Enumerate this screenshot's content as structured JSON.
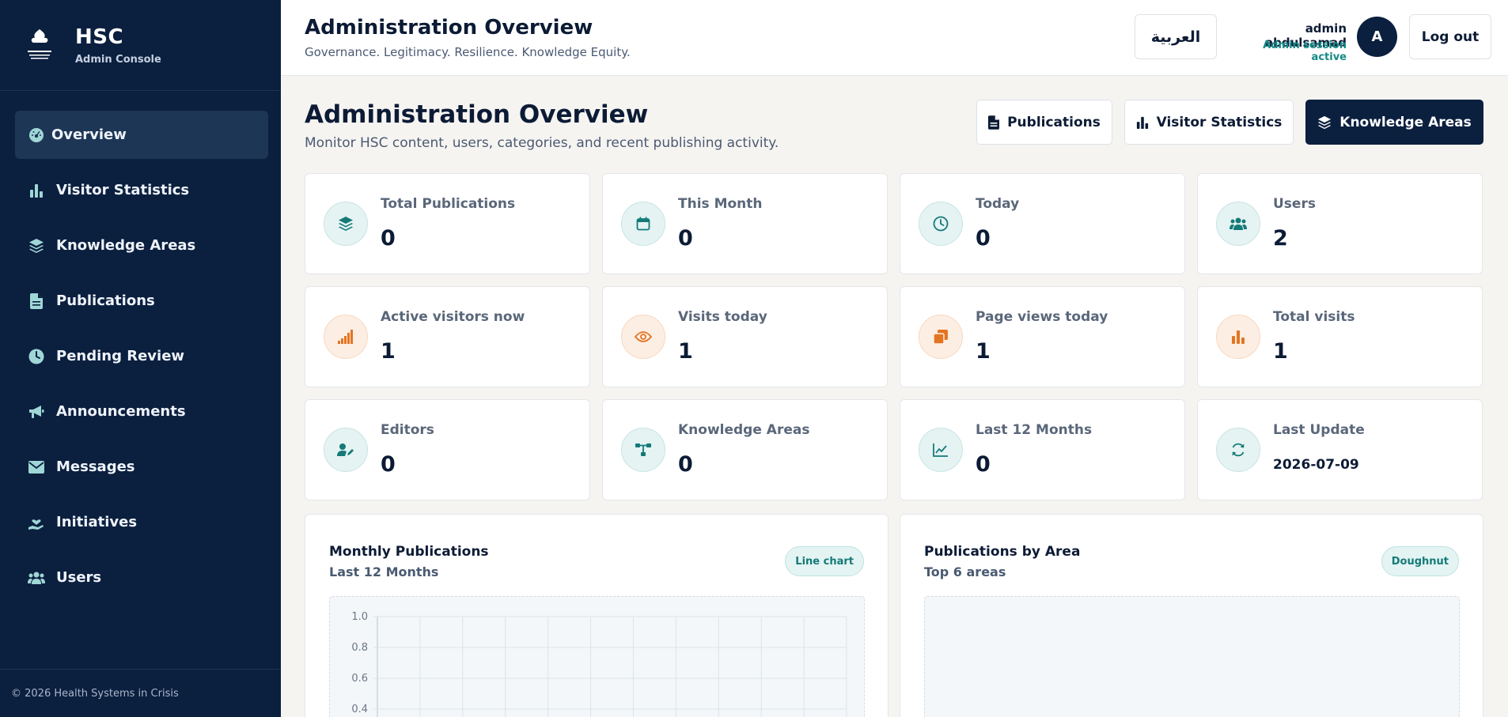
{
  "sidebar": {
    "brand_title": "HSC",
    "brand_subtitle": "Admin Console",
    "logo_text": "HSC",
    "items": [
      {
        "label": "Overview",
        "icon": "dashboard-icon",
        "active": true
      },
      {
        "label": "Visitor Statistics",
        "icon": "bar-chart-icon"
      },
      {
        "label": "Knowledge Areas",
        "icon": "layers-icon"
      },
      {
        "label": "Publications",
        "icon": "document-icon"
      },
      {
        "label": "Pending Review",
        "icon": "clock-icon"
      },
      {
        "label": "Announcements",
        "icon": "megaphone-icon"
      },
      {
        "label": "Messages",
        "icon": "envelope-icon"
      },
      {
        "label": "Initiatives",
        "icon": "hand-heart-icon"
      },
      {
        "label": "Users",
        "icon": "users-icon"
      }
    ],
    "footer": "© 2026 Health Systems in Crisis"
  },
  "header": {
    "title": "Administration Overview",
    "subtitle": "Governance. Legitimacy. Resilience. Knowledge Equity.",
    "language_button": "العربية",
    "user_name": "admin abdulsamad",
    "user_status": "Admin session active",
    "avatar_initial": "A",
    "logout_label": "Log out"
  },
  "main": {
    "title": "Administration Overview",
    "subtitle": "Monitor HSC content, users, categories, and recent publishing activity.",
    "quick_buttons": [
      {
        "label": "Publications",
        "icon": "document-icon"
      },
      {
        "label": "Visitor Statistics",
        "icon": "bar-chart-icon"
      },
      {
        "label": "Knowledge Areas",
        "icon": "layers-icon"
      }
    ],
    "stats": [
      {
        "label": "Total Publications",
        "value": "0",
        "icon": "layers-icon",
        "color": "teal"
      },
      {
        "label": "This Month",
        "value": "0",
        "icon": "calendar-icon",
        "color": "teal"
      },
      {
        "label": "Today",
        "value": "0",
        "icon": "clock-icon",
        "color": "teal"
      },
      {
        "label": "Users",
        "value": "2",
        "icon": "users-icon",
        "color": "teal"
      },
      {
        "label": "Active visitors now",
        "value": "1",
        "icon": "signal-icon",
        "color": "orange"
      },
      {
        "label": "Visits today",
        "value": "1",
        "icon": "eye-icon",
        "color": "orange"
      },
      {
        "label": "Page views today",
        "value": "1",
        "icon": "copy-icon",
        "color": "orange"
      },
      {
        "label": "Total visits",
        "value": "1",
        "icon": "bar-chart-icon",
        "color": "orange"
      },
      {
        "label": "Editors",
        "value": "0",
        "icon": "user-edit-icon",
        "color": "teal"
      },
      {
        "label": "Knowledge Areas",
        "value": "0",
        "icon": "sitemap-icon",
        "color": "teal"
      },
      {
        "label": "Last 12 Months",
        "value": "0",
        "icon": "line-chart-icon",
        "color": "teal"
      },
      {
        "label": "Last Update",
        "value": "2026-07-09",
        "icon": "refresh-icon",
        "color": "teal"
      }
    ],
    "panels": [
      {
        "title": "Monthly Publications",
        "subtitle": "Last 12 Months",
        "badge": "Line chart"
      },
      {
        "title": "Publications by Area",
        "subtitle": "Top 6 areas",
        "badge": "Doughnut"
      }
    ]
  },
  "colors": {
    "sidebar_bg": "#0b1f3f",
    "accent_teal": "#147a78",
    "accent_orange": "#e37422"
  },
  "chart_data": {
    "type": "line",
    "title": "Monthly Publications",
    "subtitle": "Last 12 Months",
    "ylim": [
      0,
      1.0
    ],
    "y_ticks": [
      "1.0",
      "0.8",
      "0.6",
      "0.4"
    ],
    "x": [],
    "series": [],
    "grid": true
  }
}
